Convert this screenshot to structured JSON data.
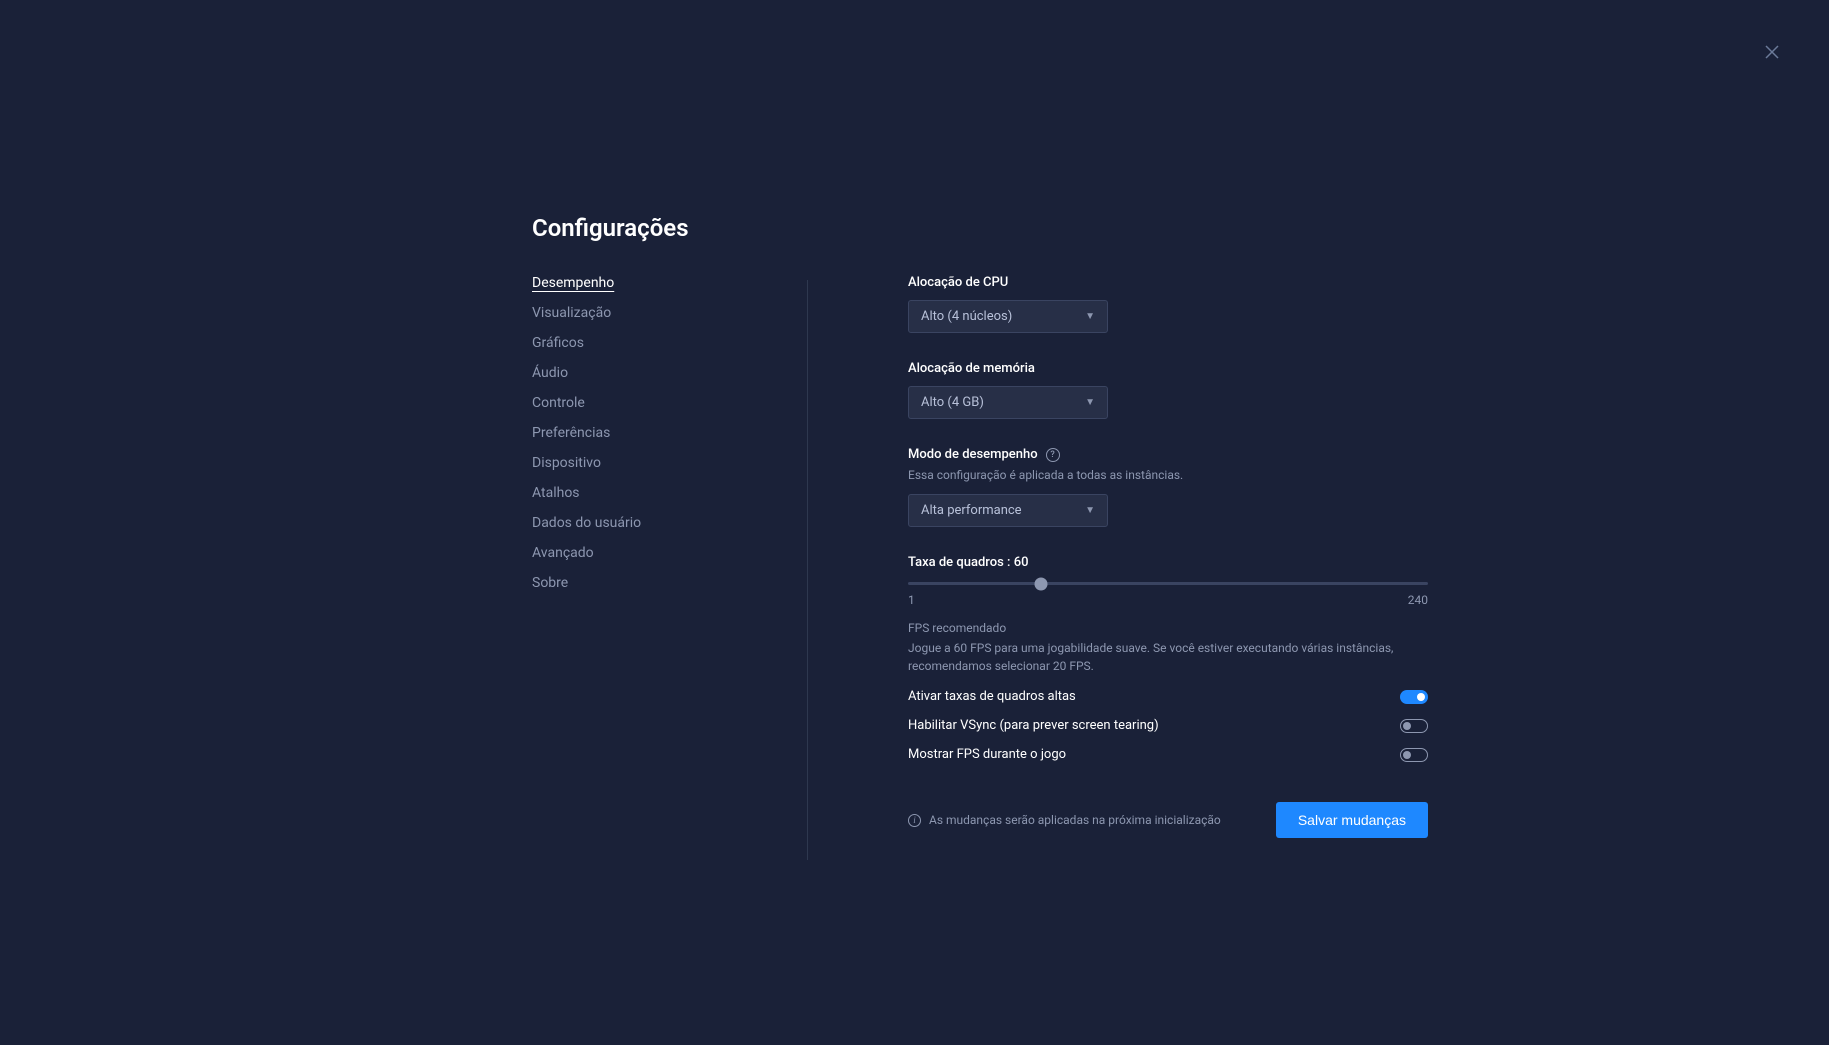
{
  "page": {
    "title": "Configurações"
  },
  "sidebar": {
    "items": [
      {
        "label": "Desempenho",
        "active": true
      },
      {
        "label": "Visualização",
        "active": false
      },
      {
        "label": "Gráficos",
        "active": false
      },
      {
        "label": "Áudio",
        "active": false
      },
      {
        "label": "Controle",
        "active": false
      },
      {
        "label": "Preferências",
        "active": false
      },
      {
        "label": "Dispositivo",
        "active": false
      },
      {
        "label": "Atalhos",
        "active": false
      },
      {
        "label": "Dados do usuário",
        "active": false
      },
      {
        "label": "Avançado",
        "active": false
      },
      {
        "label": "Sobre",
        "active": false
      }
    ]
  },
  "cpu": {
    "label": "Alocação de CPU",
    "value": "Alto (4 núcleos)"
  },
  "memory": {
    "label": "Alocação de memória",
    "value": "Alto (4 GB)"
  },
  "performance_mode": {
    "label": "Modo de desempenho",
    "description": "Essa configuração é aplicada a todas as instâncias.",
    "value": "Alta performance"
  },
  "framerate": {
    "label": "Taxa de quadros : 60",
    "min": "1",
    "max": "240",
    "value": 60,
    "percent": 25.5,
    "info_title": "FPS recomendado",
    "info_desc": "Jogue a 60 FPS para uma jogabilidade suave. Se você estiver executando várias instâncias, recomendamos selecionar 20 FPS."
  },
  "toggles": {
    "high_fps": {
      "label": "Ativar taxas de quadros altas",
      "enabled": true
    },
    "vsync": {
      "label": "Habilitar VSync (para prever screen tearing)",
      "enabled": false
    },
    "show_fps": {
      "label": "Mostrar FPS durante o jogo",
      "enabled": false
    }
  },
  "footer": {
    "note": "As mudanças serão aplicadas na próxima inicialização",
    "save_label": "Salvar mudanças"
  }
}
